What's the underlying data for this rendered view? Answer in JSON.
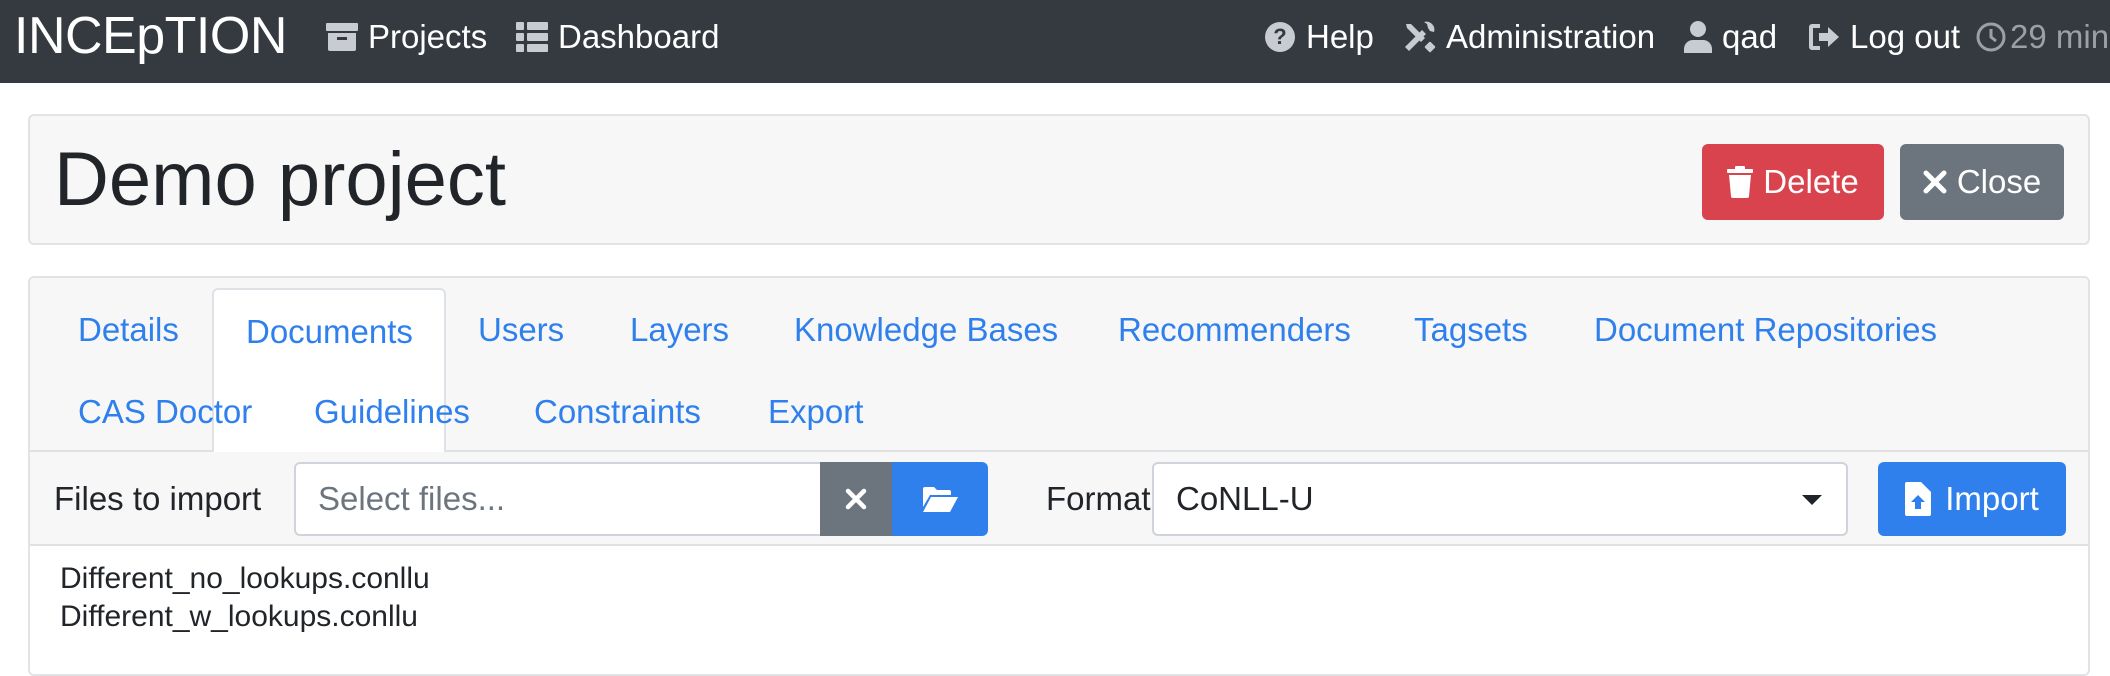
{
  "navbar": {
    "brand": "INCEpTION",
    "projects": "Projects",
    "dashboard": "Dashboard",
    "help": "Help",
    "administration": "Administration",
    "user": "qad",
    "logout": "Log out",
    "timer": "29 min"
  },
  "header": {
    "title": "Demo project",
    "delete_label": "Delete",
    "close_label": "Close"
  },
  "tabs": [
    {
      "label": "Details"
    },
    {
      "label": "Documents",
      "active": true
    },
    {
      "label": "Users"
    },
    {
      "label": "Layers"
    },
    {
      "label": "Knowledge Bases"
    },
    {
      "label": "Recommenders"
    },
    {
      "label": "Tagsets"
    },
    {
      "label": "Document Repositories"
    },
    {
      "label": "CAS Doctor"
    },
    {
      "label": "Guidelines"
    },
    {
      "label": "Constraints"
    },
    {
      "label": "Export"
    }
  ],
  "import": {
    "files_label": "Files to import",
    "files_placeholder": "Select files...",
    "format_label": "Format",
    "format_value": "CoNLL-U",
    "import_label": "Import"
  },
  "selected_files": [
    "Different_no_lookups.conllu",
    "Different_w_lookups.conllu"
  ],
  "colors": {
    "navbar": "#343a40",
    "primary": "#2f80ed",
    "danger": "#d9434e",
    "secondary": "#6c757d"
  }
}
